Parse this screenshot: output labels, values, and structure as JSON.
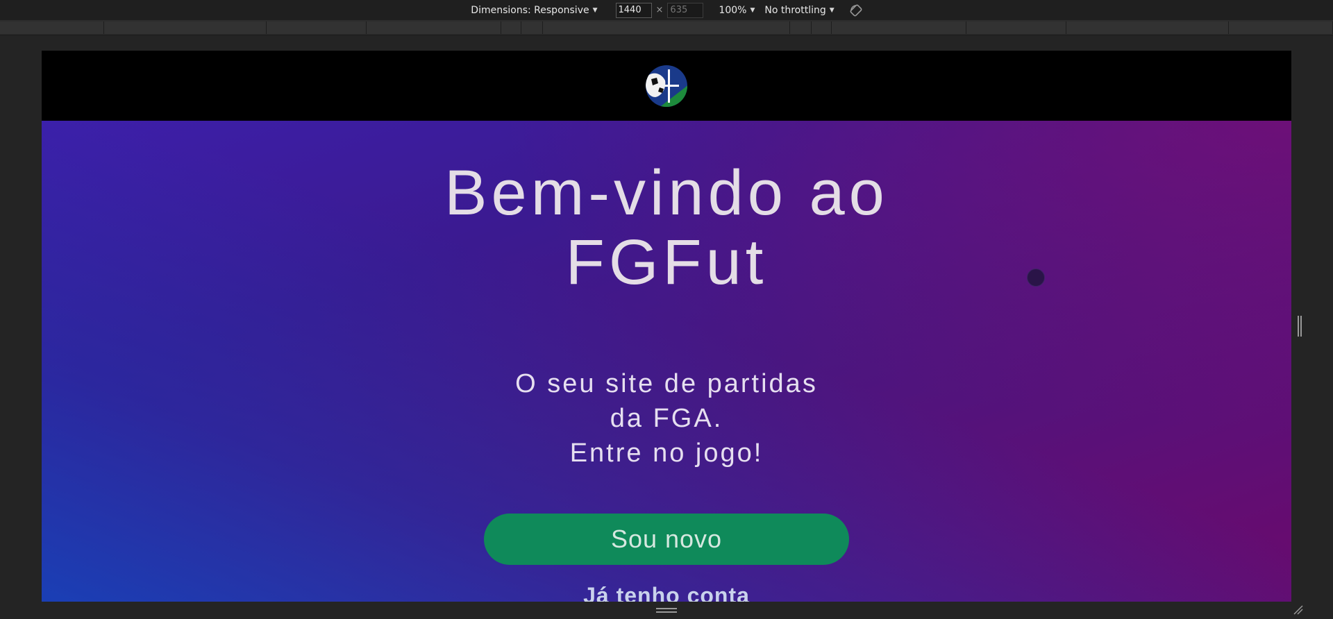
{
  "devtools": {
    "dimensions_label": "Dimensions: Responsive",
    "width_value": "1440",
    "height_placeholder": "635",
    "times": "×",
    "zoom_label": "100%",
    "throttling_label": "No throttling"
  },
  "site": {
    "title": "Bem-vindo ao FGFut",
    "subtitle_line1": "O seu site de partidas da FGA.",
    "subtitle_line2": "Entre no jogo!",
    "new_user_button": "Sou novo",
    "login_link": "Já tenho conta"
  },
  "colors": {
    "header_bg": "#000000",
    "button_green": "#0f8a5a",
    "gradient_blue": "#1246be",
    "gradient_purple": "#6a0a6c"
  }
}
